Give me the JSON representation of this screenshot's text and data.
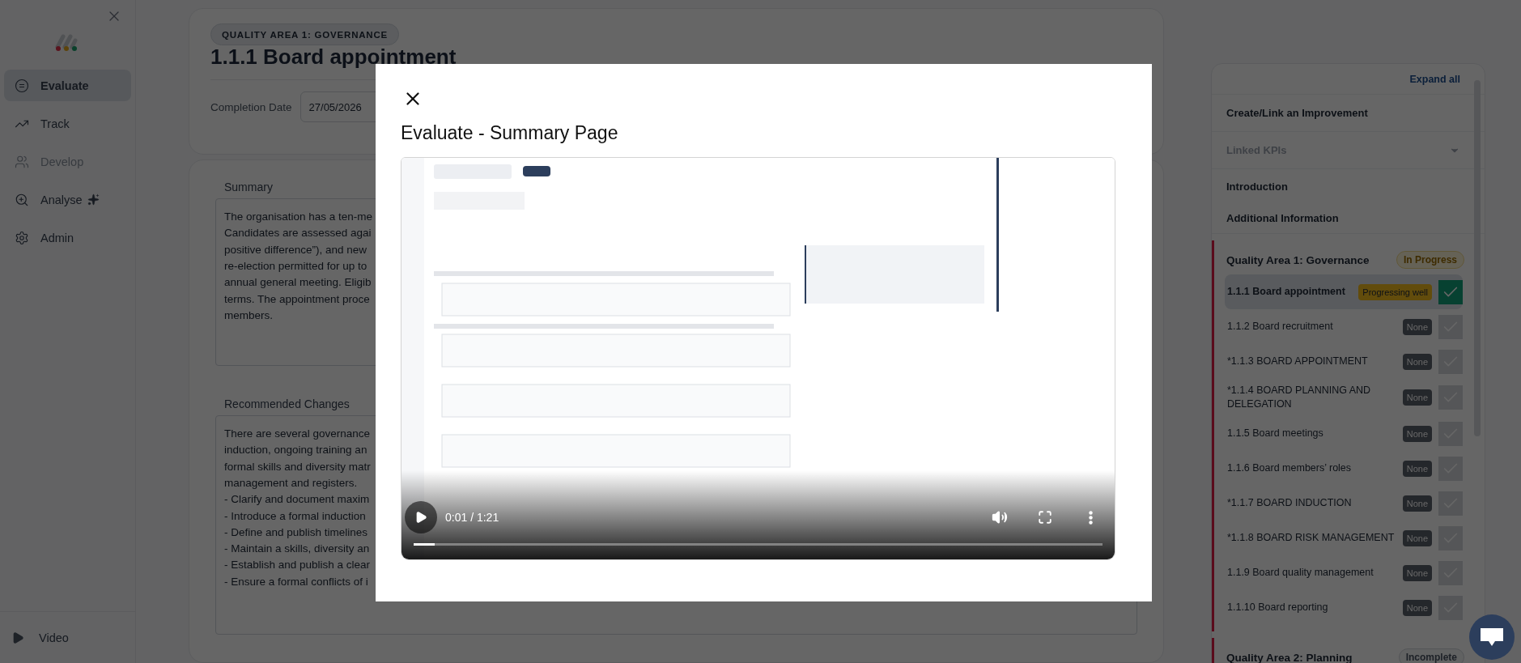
{
  "sidebar": {
    "items": [
      {
        "label": "Evaluate",
        "selected": true,
        "disabled": false
      },
      {
        "label": "Track",
        "selected": false,
        "disabled": false
      },
      {
        "label": "Develop",
        "selected": false,
        "disabled": true
      },
      {
        "label": "Analyse",
        "selected": false,
        "disabled": false
      },
      {
        "label": "Admin",
        "selected": false,
        "disabled": false
      }
    ],
    "footer": {
      "label": "Video"
    }
  },
  "header": {
    "area_pill": "QUALITY AREA 1: GOVERNANCE",
    "title": "1.1.1 Board appointment",
    "completion_label": "Completion Date",
    "completion_value": "27/05/2026"
  },
  "summary": {
    "label": "Summary",
    "lines": [
      "The organisation has a ten-me",
      "Candidates are assessed agai",
      "positive difference”), and new",
      "re-election permitted for up to",
      "annual general meeting. Eligib",
      "terms. The appointment proce",
      "members."
    ]
  },
  "recommended": {
    "label": "Recommended Changes",
    "lines": [
      "There are several governance",
      "induction, ongoing training an",
      "formal skills and diversity matr",
      "management and registers.",
      "- Clarify and document maxim",
      "- Introduce a formal induction",
      "- Define and publish timelines",
      "- Maintain a skills, diversity an",
      "- Establish and publish a clear",
      "- Ensure a formal conflicts of i"
    ]
  },
  "panel": {
    "expand_all": "Expand all",
    "links": [
      {
        "label": "Create/Link an Improvement",
        "kind": "link",
        "disabled": false
      },
      {
        "label": "Linked KPIs",
        "kind": "dropdown",
        "disabled": true
      }
    ],
    "sections": [
      "Introduction",
      "Additional Information"
    ],
    "areas": [
      {
        "title": "Quality Area 1: Governance",
        "status": "In Progress",
        "kind": "progress",
        "items": [
          {
            "label": "1.1.1 Board appointment",
            "badge": "Progressing well",
            "kind": "progress",
            "selected": true,
            "checked": true
          },
          {
            "label": "1.1.2 Board recruitment",
            "badge": "None",
            "kind": "none",
            "selected": false,
            "checked": false
          },
          {
            "label": "*1.1.3 BOARD APPOINTMENT",
            "badge": "None",
            "kind": "none",
            "selected": false,
            "checked": false
          },
          {
            "label": "*1.1.4 BOARD PLANNING AND DELEGATION",
            "badge": "None",
            "kind": "none",
            "selected": false,
            "checked": false
          },
          {
            "label": "1.1.5 Board meetings",
            "badge": "None",
            "kind": "none",
            "selected": false,
            "checked": false
          },
          {
            "label": "1.1.6 Board members’ roles",
            "badge": "None",
            "kind": "none",
            "selected": false,
            "checked": false
          },
          {
            "label": "*1.1.7 BOARD INDUCTION",
            "badge": "None",
            "kind": "none",
            "selected": false,
            "checked": false
          },
          {
            "label": "*1.1.8 BOARD RISK MANAGEMENT",
            "badge": "None",
            "kind": "none",
            "selected": false,
            "checked": false
          },
          {
            "label": "1.1.9 Board quality management",
            "badge": "None",
            "kind": "none",
            "selected": false,
            "checked": false
          },
          {
            "label": "1.1.10 Board reporting",
            "badge": "None",
            "kind": "none",
            "selected": false,
            "checked": false
          }
        ]
      },
      {
        "title": "Quality Area 2: Planning",
        "status": "Incomplete",
        "kind": "incomplete"
      }
    ]
  },
  "modal": {
    "title": "Evaluate - Summary Page",
    "video": {
      "kind": "picture",
      "time": "0:01 / 1:21",
      "level": 0.03
    }
  }
}
